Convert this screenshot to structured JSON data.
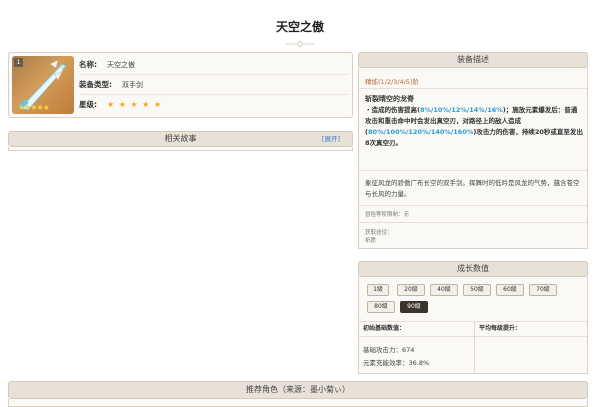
{
  "page": {
    "title": "天空之傲"
  },
  "weapon": {
    "rarity_num": "1",
    "name_label": "名称:",
    "name_value": "天空之傲",
    "type_label": "装备类型:",
    "type_value": "双手剑",
    "star_label": "星级:",
    "stars": "★ ★ ★ ★ ★",
    "thumb_stars": "★★★★★"
  },
  "story": {
    "title": "相关故事",
    "expand": "[展开]"
  },
  "description": {
    "title": "装备描述",
    "refine": "精炼(1/2/3/4/5)阶",
    "skill_name": "斩裂晴空的龙脊",
    "skill_p1": "・造成的伤害提高(",
    "skill_hl1": "8%/10%/12%/14%/16%",
    "skill_p2": ")；施放元素爆发后：普通攻击和重击命中时会发出真空刃，对路径上的敌人造成(",
    "skill_hl2": "80%/100%/120%/140%/160%",
    "skill_p3": ")攻击力的伤害，持续20秒或直至发出8次真空刃。",
    "lore": "象征风龙的骄傲广布长空的双手剑。挥舞时的低吟是风龙的气势，蕴含苍空与长风的力量。",
    "limit": "冒险等阶限制：无",
    "source_label": "获取途径：",
    "source_value": "祈愿"
  },
  "growth": {
    "title": "成长数值",
    "levels": [
      "1级",
      "20级",
      "40级",
      "50级",
      "60级",
      "70级",
      "80级",
      "90级"
    ],
    "base_label": "初始基础数值：",
    "avg_label": "平均每级提升：",
    "atk": "基础攻击力：674",
    "er": "元素充能效率：36.8%"
  },
  "recommend": {
    "title": "推荐角色（来源：墨小菊ぃ）"
  },
  "colors": {
    "accent_blue": "#2b9cd8",
    "active_level": "#3b342c",
    "star_gold": "#f5a623"
  }
}
